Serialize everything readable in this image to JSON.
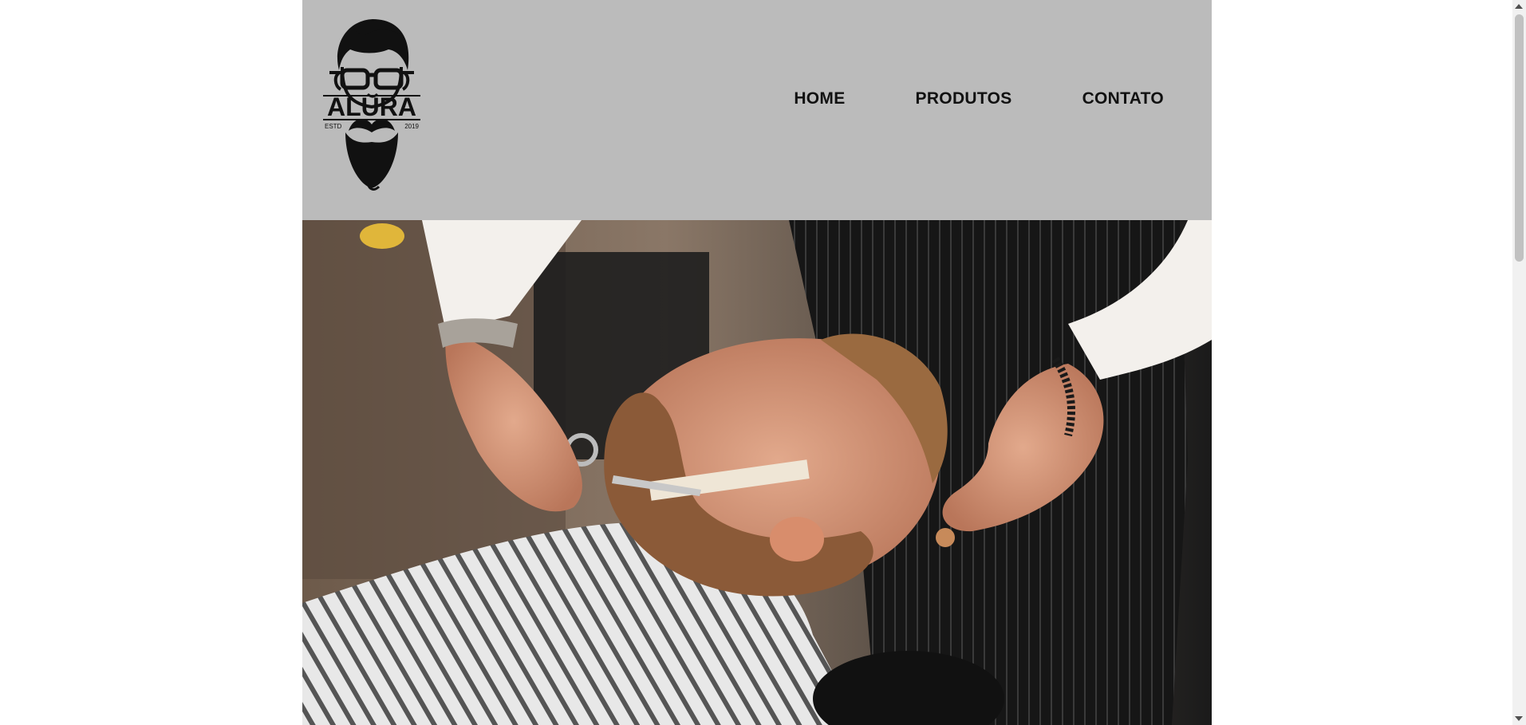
{
  "logo": {
    "brand": "ALURA",
    "est_left": "ESTD",
    "est_right": "2019"
  },
  "nav": {
    "items": [
      {
        "label": "HOME"
      },
      {
        "label": "PRODUTOS"
      },
      {
        "label": "CONTATO"
      }
    ]
  },
  "hero": {
    "icon": "barber-trimming-beard-photo"
  },
  "colors": {
    "header_bg": "#bbbbbb",
    "page_bg": "#ffffff",
    "nav_text": "#111111"
  }
}
